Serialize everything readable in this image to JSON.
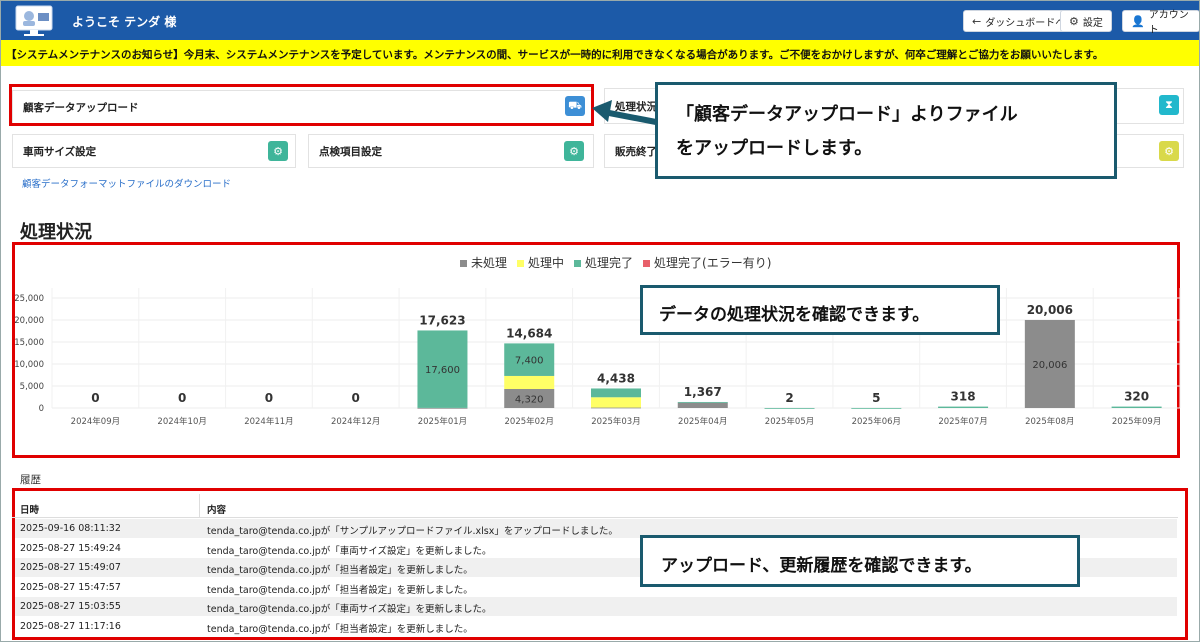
{
  "header": {
    "welcome": "ようこそ テンダ 様",
    "dashboard_btn": "ダッシュボードへ",
    "settings_btn": "設定",
    "account_btn": "アカウント"
  },
  "notice": "【システムメンテナンスのお知らせ】今月末、システムメンテナンスを予定しています。メンテナンスの間、サービスが一時的に利用できなくなる場合があります。ご不便をおかけしますが、何卒ご理解とご協力をお願いいたします。",
  "cards": {
    "upload": "顧客データアップロード",
    "status": "処理状況",
    "vehicle": "車両サイズ設定",
    "inspection": "点検項目設定",
    "sales": "販売終了"
  },
  "download_link": "顧客データフォーマットファイルのダウンロード",
  "section_title": "処理状況",
  "chart_data": {
    "type": "bar",
    "stacked": true,
    "legend_position": "top-center",
    "grid": true,
    "categories": [
      "2024年09月",
      "2024年10月",
      "2024年11月",
      "2024年12月",
      "2025年01月",
      "2025年02月",
      "2025年03月",
      "2025年04月",
      "2025年05月",
      "2025年06月",
      "2025年07月",
      "2025年08月",
      "2025年09月"
    ],
    "series": [
      {
        "name": "未処理",
        "color": "#8c8c8c",
        "values": [
          0,
          0,
          0,
          0,
          23,
          4320,
          100,
          1200,
          0,
          0,
          0,
          20006,
          0
        ]
      },
      {
        "name": "処理中",
        "color": "#ffff66",
        "values": [
          0,
          0,
          0,
          0,
          0,
          2964,
          2338,
          0,
          0,
          0,
          0,
          0,
          0
        ]
      },
      {
        "name": "処理完了",
        "color": "#5cb89a",
        "values": [
          0,
          0,
          0,
          0,
          17600,
          7400,
          2000,
          167,
          2,
          5,
          318,
          0,
          320
        ]
      },
      {
        "name": "処理完了(エラー有り)",
        "color": "#e8606a",
        "values": [
          0,
          0,
          0,
          0,
          0,
          0,
          0,
          0,
          0,
          0,
          0,
          0,
          0
        ]
      }
    ],
    "totals": [
      0,
      0,
      0,
      0,
      17623,
      14684,
      4438,
      1367,
      2,
      5,
      318,
      20006,
      320
    ],
    "total_labels": [
      "0",
      "0",
      "0",
      "0",
      "17,623",
      "14,684",
      "4,438",
      "1,367",
      "2",
      "5",
      "318",
      "20,006",
      "320"
    ],
    "inner_labels": [
      {
        "category": "2025年01月",
        "text": "17,600"
      },
      {
        "category": "2025年02月",
        "text": "7,400"
      },
      {
        "category": "2025年02月",
        "text": "4,320"
      },
      {
        "category": "2025年08月",
        "text": "20,006"
      }
    ],
    "yticks": [
      "0",
      "5,000",
      "10,000",
      "15,000",
      "20,000",
      "25,000"
    ],
    "ylim": [
      0,
      25000
    ]
  },
  "history": {
    "title": "履歴",
    "col_date": "日時",
    "col_content": "内容",
    "rows": [
      {
        "date": "2025-09-16 08:11:32",
        "content": "tenda_taro@tenda.co.jpが「サンプルアップロードファイル.xlsx」をアップロードしました。"
      },
      {
        "date": "2025-08-27 15:49:24",
        "content": "tenda_taro@tenda.co.jpが「車両サイズ設定」を更新しました。"
      },
      {
        "date": "2025-08-27 15:49:07",
        "content": "tenda_taro@tenda.co.jpが「担当者設定」を更新しました。"
      },
      {
        "date": "2025-08-27 15:47:57",
        "content": "tenda_taro@tenda.co.jpが「担当者設定」を更新しました。"
      },
      {
        "date": "2025-08-27 15:03:55",
        "content": "tenda_taro@tenda.co.jpが「車両サイズ設定」を更新しました。"
      },
      {
        "date": "2025-08-27 11:17:16",
        "content": "tenda_taro@tenda.co.jpが「担当者設定」を更新しました。"
      }
    ]
  },
  "callouts": {
    "upload": [
      "「顧客データアップロード」よりファイル",
      "をアップロードします。"
    ],
    "chart": "データの処理状況を確認できます。",
    "history": "アップロード、更新履歴を確認できます。"
  },
  "colors": {
    "header_bg": "#1c5aa8",
    "notice_bg": "#ffff00",
    "highlight_red": "#e00000",
    "callout_border": "#1a5a6e"
  }
}
